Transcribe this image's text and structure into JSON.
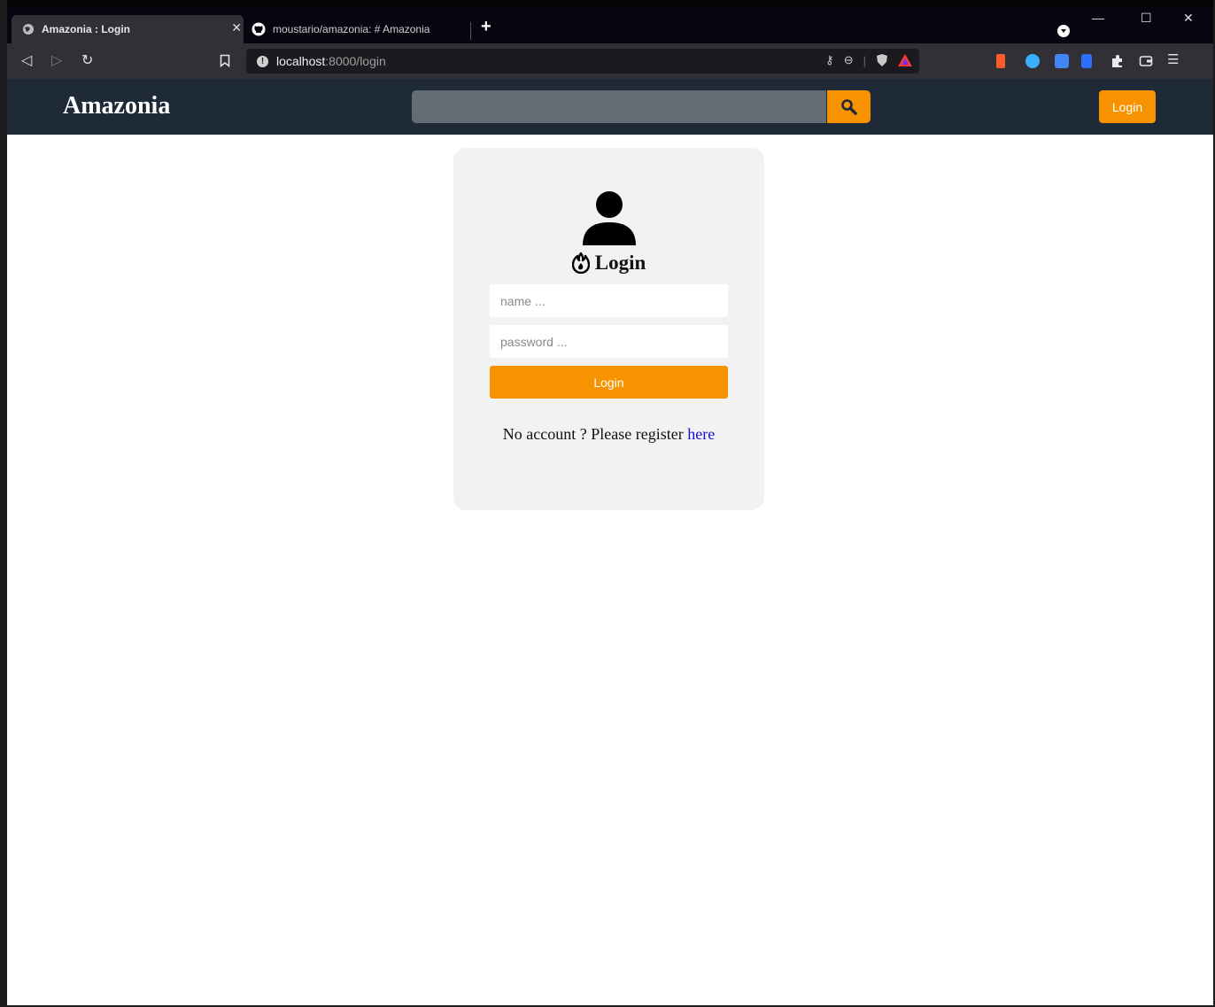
{
  "browser": {
    "tabs": [
      {
        "title": "Amazonia : Login",
        "active": true
      },
      {
        "title": "moustario/amazonia: # Amazonia",
        "active": false
      }
    ],
    "new_tab": "+",
    "url_host": "localhost",
    "url_path": ":8000/login",
    "window_controls": {
      "minimize": "—",
      "maximize": "☐",
      "close": "✕"
    }
  },
  "site": {
    "brand": "Amazonia",
    "search": {
      "placeholder": "",
      "value": ""
    },
    "header_login_label": "Login"
  },
  "login_card": {
    "title": "Login",
    "name_placeholder": "name ...",
    "password_placeholder": "password ...",
    "submit_label": "Login",
    "register_text": "No account ? Please register",
    "register_link": "here"
  },
  "colors": {
    "accent": "#f79200",
    "header_bg": "#1f2a38",
    "card_bg": "#f2f2f2",
    "link": "#1a0dd6"
  },
  "icons": {
    "search": "magnifier-icon",
    "user": "user-icon",
    "title": "fire-icon"
  }
}
